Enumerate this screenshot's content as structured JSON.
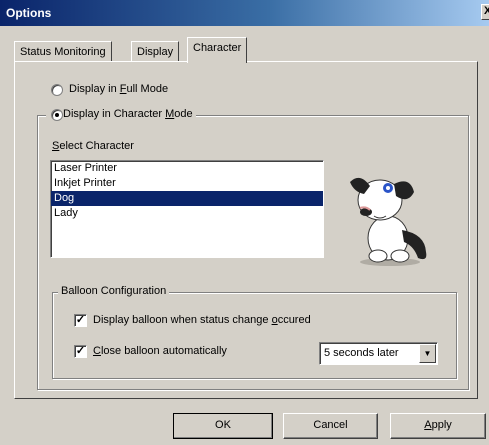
{
  "window": {
    "title": "Options",
    "close_glyph": "X"
  },
  "tabs": [
    {
      "label": "Status Monitoring"
    },
    {
      "label": "Display"
    },
    {
      "label": "Character",
      "selected": true
    }
  ],
  "character_tab": {
    "full_mode": {
      "pre": "Display in ",
      "key": "F",
      "post": "ull Mode",
      "selected": false
    },
    "char_mode": {
      "pre": "Display in Character ",
      "key": "M",
      "post": "ode",
      "selected": true
    },
    "select_label": {
      "key": "S",
      "post": "elect Character"
    },
    "characters": [
      "Laser Printer",
      "Inkjet Printer",
      "Dog",
      "Lady"
    ],
    "selected_character": "Dog",
    "preview_icon": "dog-character-icon"
  },
  "balloon": {
    "title": "Balloon Configuration",
    "status_change": {
      "pre": "Display balloon when status change ",
      "key": "o",
      "post": "ccured",
      "checked": true
    },
    "auto_close": {
      "pre": "",
      "key": "C",
      "post": "lose balloon automatically",
      "checked": true
    },
    "close_delay": "5 seconds later"
  },
  "buttons": {
    "ok": "OK",
    "cancel": "Cancel",
    "apply": {
      "key": "A",
      "post": "pply"
    }
  },
  "colors": {
    "titlebar": "#0a246a",
    "selection": "#0a246a",
    "face": "#d4d0c8"
  }
}
